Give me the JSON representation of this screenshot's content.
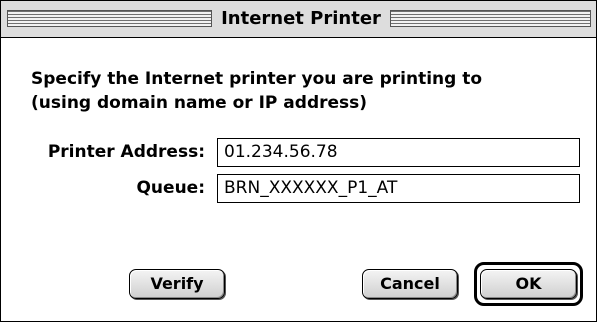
{
  "dialog": {
    "title": "Internet Printer"
  },
  "instructions": {
    "line1": "Specify the Internet printer you are printing to",
    "line2": "(using domain name or IP address)"
  },
  "fields": {
    "printer_address": {
      "label": "Printer Address:",
      "value": "01.234.56.78"
    },
    "queue": {
      "label": "Queue:",
      "value": "BRN_XXXXXX_P1_AT"
    }
  },
  "buttons": {
    "verify": "Verify",
    "cancel": "Cancel",
    "ok": "OK"
  }
}
